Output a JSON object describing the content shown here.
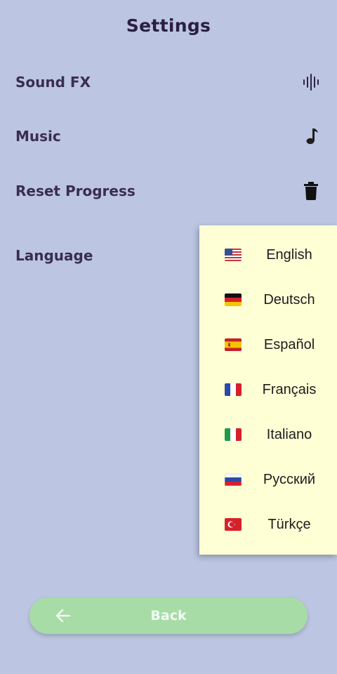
{
  "header": {
    "title": "Settings"
  },
  "settings": {
    "sound_fx": {
      "label": "Sound FX",
      "icon": "audio-wave-icon"
    },
    "music": {
      "label": "Music",
      "icon": "music-note-icon"
    },
    "reset": {
      "label": "Reset Progress",
      "icon": "trash-icon"
    },
    "language": {
      "label": "Language"
    }
  },
  "languages": [
    {
      "label": "English",
      "flag": "us-flag-icon"
    },
    {
      "label": "Deutsch",
      "flag": "germany-flag-icon"
    },
    {
      "label": "Español",
      "flag": "spain-flag-icon"
    },
    {
      "label": "Français",
      "flag": "france-flag-icon"
    },
    {
      "label": "Italiano",
      "flag": "italy-flag-icon"
    },
    {
      "label": "Русский",
      "flag": "russia-flag-icon"
    },
    {
      "label": "Türkçe",
      "flag": "turkey-flag-icon"
    }
  ],
  "footer": {
    "back_label": "Back",
    "back_icon": "arrow-left-icon"
  },
  "colors": {
    "background": "#bcc5e1",
    "dropdown_bg": "#ffffd6",
    "back_button": "#a7dca6",
    "text": "#3a2d52"
  }
}
